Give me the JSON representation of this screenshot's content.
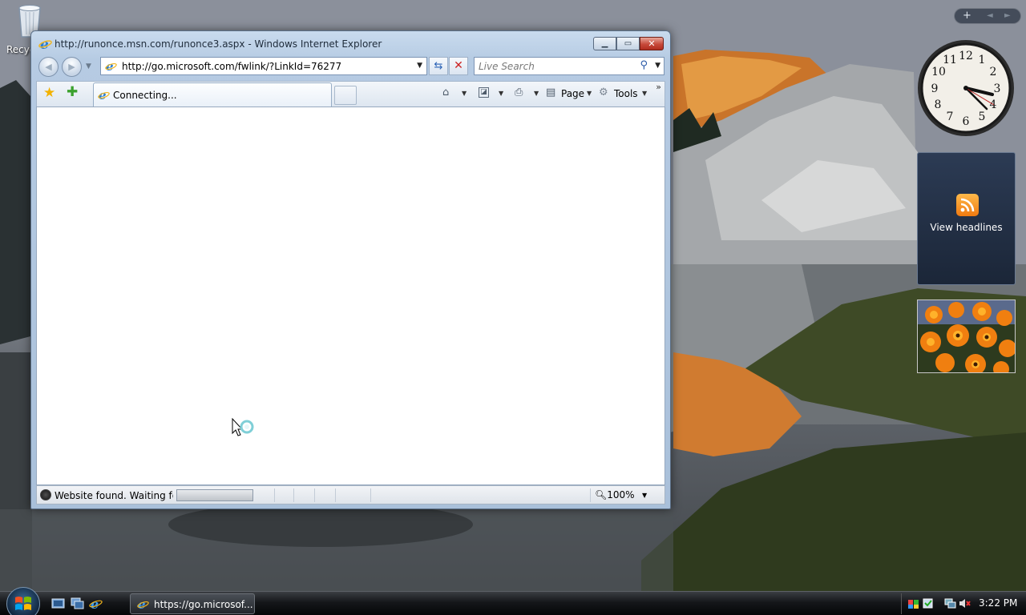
{
  "desktop": {
    "recycle_bin_label": "Recycle Bin"
  },
  "ie": {
    "window_title": "http://runonce.msn.com/runonce3.aspx - Windows Internet Explorer",
    "address_url": "http://go.microsoft.com/fwlink/?LinkId=76277",
    "search_placeholder": "Live Search",
    "tab_label": "Connecting...",
    "page_menu_label": "Page",
    "tools_menu_label": "Tools",
    "status_text": "Website found. Waiting for reply...",
    "zoom_level": "100%",
    "progress_fraction": 0.0
  },
  "gadgets": {
    "clock_time": "3:22",
    "feed_label": "View headlines"
  },
  "taskbar": {
    "task_label": "https://go.microsof...",
    "clock": "3:22 PM"
  },
  "colors": {
    "accent": "#2a62b5",
    "close_red": "#c7493a",
    "rss_orange": "#f07a10"
  },
  "icons": [
    "recycle-bin-icon",
    "ie-logo-icon",
    "back-icon",
    "forward-icon",
    "refresh-icon",
    "stop-icon",
    "search-icon",
    "favorites-star-icon",
    "add-favorites-icon",
    "home-icon",
    "feeds-icon",
    "print-icon",
    "page-icon",
    "tools-gear-icon",
    "zoom-icon",
    "windows-logo-icon"
  ]
}
